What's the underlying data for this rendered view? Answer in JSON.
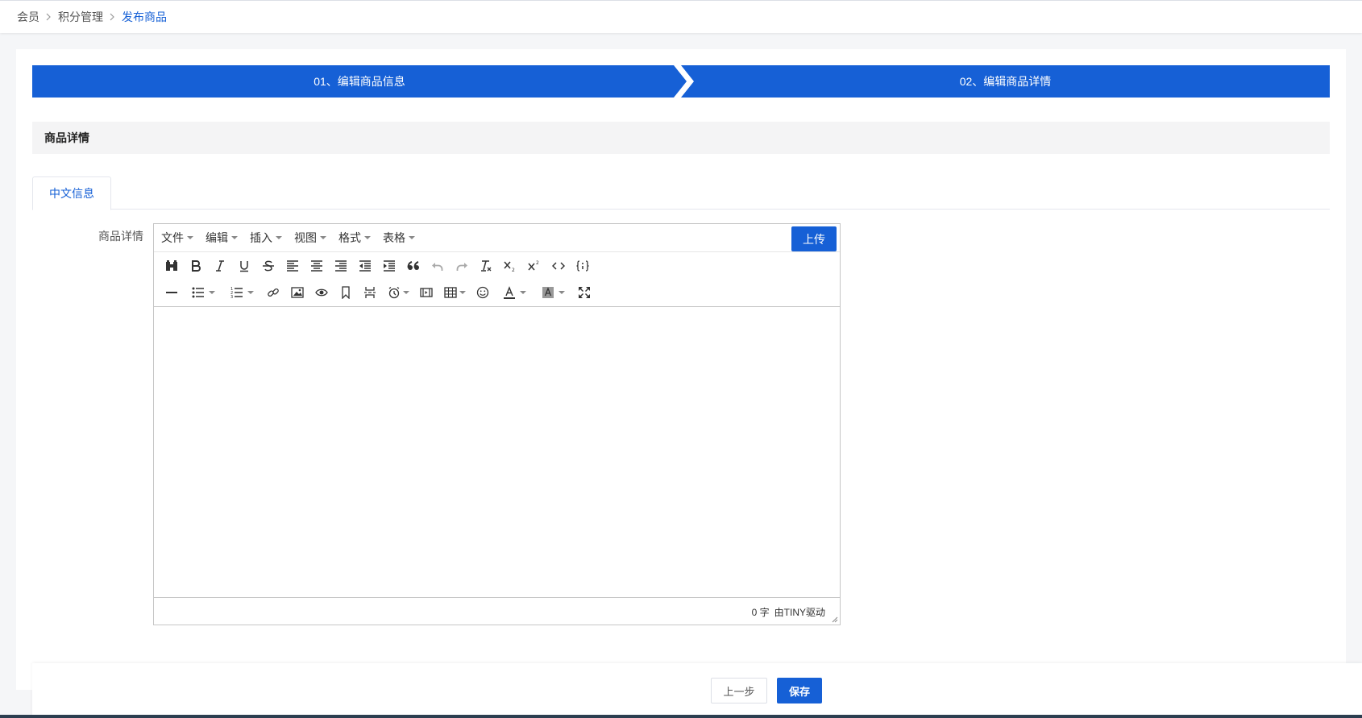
{
  "breadcrumb": {
    "items": [
      "会员",
      "积分管理",
      "发布商品"
    ]
  },
  "steps": {
    "step1": "01、编辑商品信息",
    "step2": "02、编辑商品详情"
  },
  "section": {
    "title": "商品详情"
  },
  "tabs": {
    "active": "中文信息"
  },
  "form": {
    "label": "商品详情"
  },
  "editor": {
    "menus": [
      "文件",
      "编辑",
      "插入",
      "视图",
      "格式",
      "表格"
    ],
    "upload_label": "上传",
    "toolbar_row1_icons": [
      "find-replace-icon",
      "bold-icon",
      "italic-icon",
      "underline-icon",
      "strikethrough-icon",
      "align-left-icon",
      "align-center-icon",
      "align-right-icon",
      "outdent-icon",
      "indent-icon",
      "blockquote-icon",
      "undo-icon",
      "redo-icon",
      "clear-format-icon",
      "subscript-icon",
      "superscript-icon",
      "code-icon",
      "code-sample-icon"
    ],
    "toolbar_row2_icons": [
      "horizontal-rule-icon",
      "bullet-list-icon",
      "numbered-list-icon",
      "link-icon",
      "image-icon",
      "preview-icon",
      "anchor-icon",
      "page-break-icon",
      "insert-datetime-icon",
      "media-icon",
      "table-icon",
      "emoticons-icon",
      "text-color-icon",
      "background-color-icon",
      "fullscreen-icon"
    ],
    "word_count": "0 字",
    "powered_by": "由TINY驱动"
  },
  "footer": {
    "prev_label": "上一步",
    "save_label": "保存"
  },
  "colors": {
    "primary": "#1660d6",
    "section_bg": "#f4f4f5"
  }
}
